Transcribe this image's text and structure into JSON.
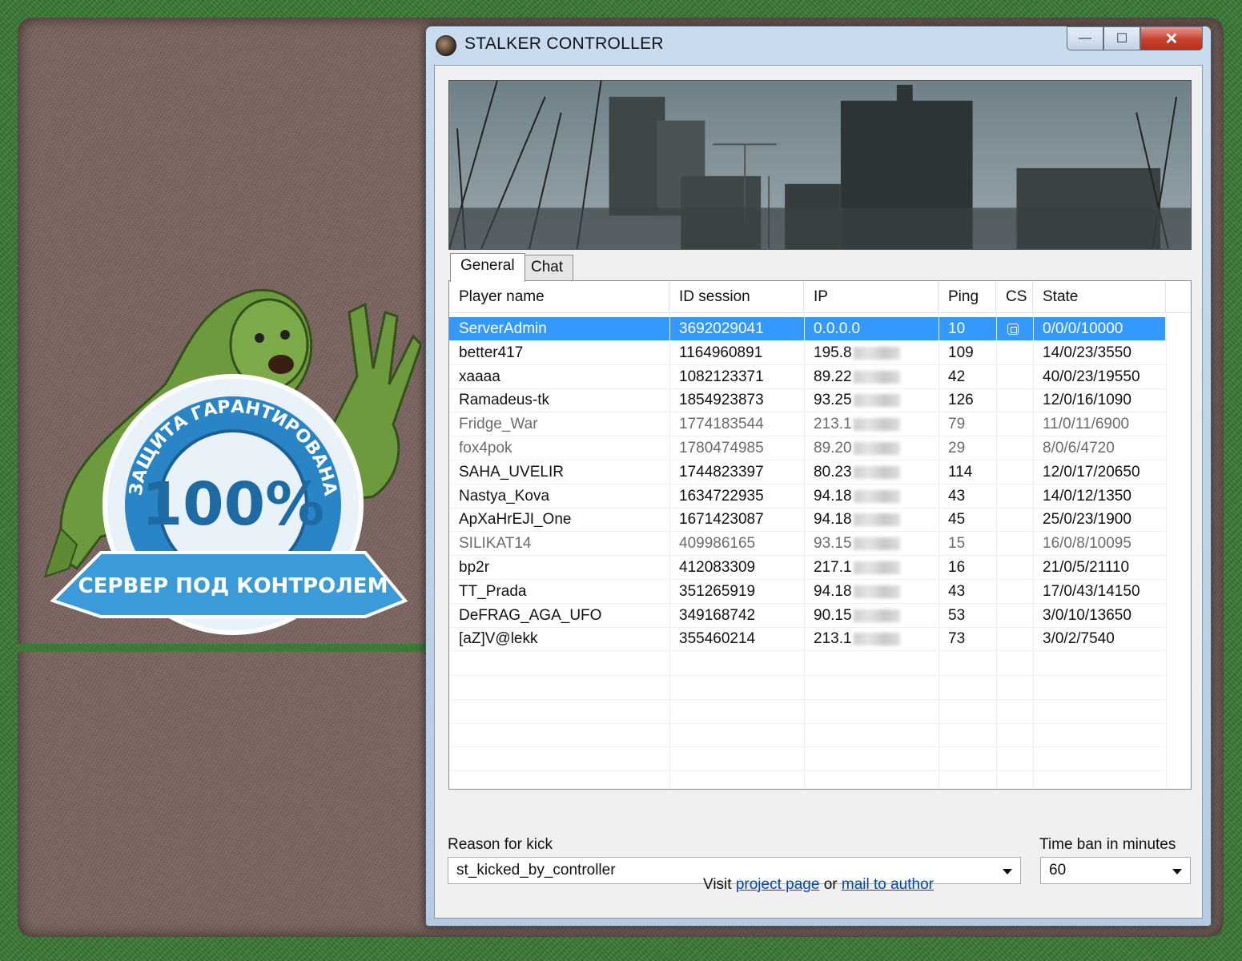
{
  "window": {
    "title": "STALKER CONTROLLER",
    "minimize": "—",
    "maximize": "☐",
    "close": "✕"
  },
  "logo": {
    "percent": "100%",
    "ring_text": "ЗАЩИТА ГАРАНТИРОВАНА",
    "ribbon_text": "СЕРВЕР ПОД КОНТРОЛЕМ"
  },
  "tabs": [
    {
      "label": "General",
      "active": true
    },
    {
      "label": "Chat",
      "active": false
    }
  ],
  "table": {
    "columns": [
      "Player name",
      "ID session",
      "IP",
      "Ping",
      "CS",
      "State"
    ],
    "rows": [
      {
        "name": "ServerAdmin",
        "id": "3692029041",
        "ip": "0.0.0.0",
        "ip_masked": false,
        "ping": "10",
        "cs": true,
        "state": "0/0/0/10000",
        "selected": true,
        "dim": false
      },
      {
        "name": "better417",
        "id": "1164960891",
        "ip": "195.8",
        "ip_masked": true,
        "ping": "109",
        "cs": false,
        "state": "14/0/23/3550",
        "selected": false,
        "dim": false
      },
      {
        "name": "xaaaa",
        "id": "1082123371",
        "ip": "89.22",
        "ip_masked": true,
        "ping": "42",
        "cs": false,
        "state": "40/0/23/19550",
        "selected": false,
        "dim": false
      },
      {
        "name": "Ramadeus-tk",
        "id": "1854923873",
        "ip": "93.25",
        "ip_masked": true,
        "ping": "126",
        "cs": false,
        "state": "12/0/16/1090",
        "selected": false,
        "dim": false
      },
      {
        "name": "Fridge_War",
        "id": "1774183544",
        "ip": "213.1",
        "ip_masked": true,
        "ping": "79",
        "cs": false,
        "state": "11/0/11/6900",
        "selected": false,
        "dim": true
      },
      {
        "name": "fox4pok",
        "id": "1780474985",
        "ip": "89.20",
        "ip_masked": true,
        "ping": "29",
        "cs": false,
        "state": "8/0/6/4720",
        "selected": false,
        "dim": true
      },
      {
        "name": "SAHA_UVELIR",
        "id": "1744823397",
        "ip": "80.23",
        "ip_masked": true,
        "ping": "114",
        "cs": false,
        "state": "12/0/17/20650",
        "selected": false,
        "dim": false
      },
      {
        "name": "Nastya_Kova",
        "id": "1634722935",
        "ip": "94.18",
        "ip_masked": true,
        "ping": "43",
        "cs": false,
        "state": "14/0/12/1350",
        "selected": false,
        "dim": false
      },
      {
        "name": "ApXaHrEJI_One",
        "id": "1671423087",
        "ip": "94.18",
        "ip_masked": true,
        "ping": "45",
        "cs": false,
        "state": "25/0/23/1900",
        "selected": false,
        "dim": false
      },
      {
        "name": "SILIKAT14",
        "id": "409986165",
        "ip": "93.15",
        "ip_masked": true,
        "ping": "15",
        "cs": false,
        "state": "16/0/8/10095",
        "selected": false,
        "dim": true
      },
      {
        "name": "bp2r",
        "id": "412083309",
        "ip": "217.1",
        "ip_masked": true,
        "ping": "16",
        "cs": false,
        "state": "21/0/5/21110",
        "selected": false,
        "dim": false
      },
      {
        "name": "TT_Prada",
        "id": "351265919",
        "ip": "94.18",
        "ip_masked": true,
        "ping": "43",
        "cs": false,
        "state": "17/0/43/14150",
        "selected": false,
        "dim": false
      },
      {
        "name": "DeFRAG_AGA_UFO",
        "id": "349168742",
        "ip": "90.15",
        "ip_masked": true,
        "ping": "53",
        "cs": false,
        "state": "3/0/10/13650",
        "selected": false,
        "dim": false
      },
      {
        "name": "[aZ]V@lekk",
        "id": "355460214",
        "ip": "213.1",
        "ip_masked": true,
        "ping": "73",
        "cs": false,
        "state": "3/0/2/7540",
        "selected": false,
        "dim": false
      }
    ]
  },
  "kick": {
    "reason_label": "Reason for kick",
    "reason_value": "st_kicked_by_controller",
    "time_label": "Time ban in minutes",
    "time_value": "60"
  },
  "footer": {
    "prefix": "Visit",
    "link1": "project page",
    "middle": "or",
    "link2": "mail to author"
  }
}
